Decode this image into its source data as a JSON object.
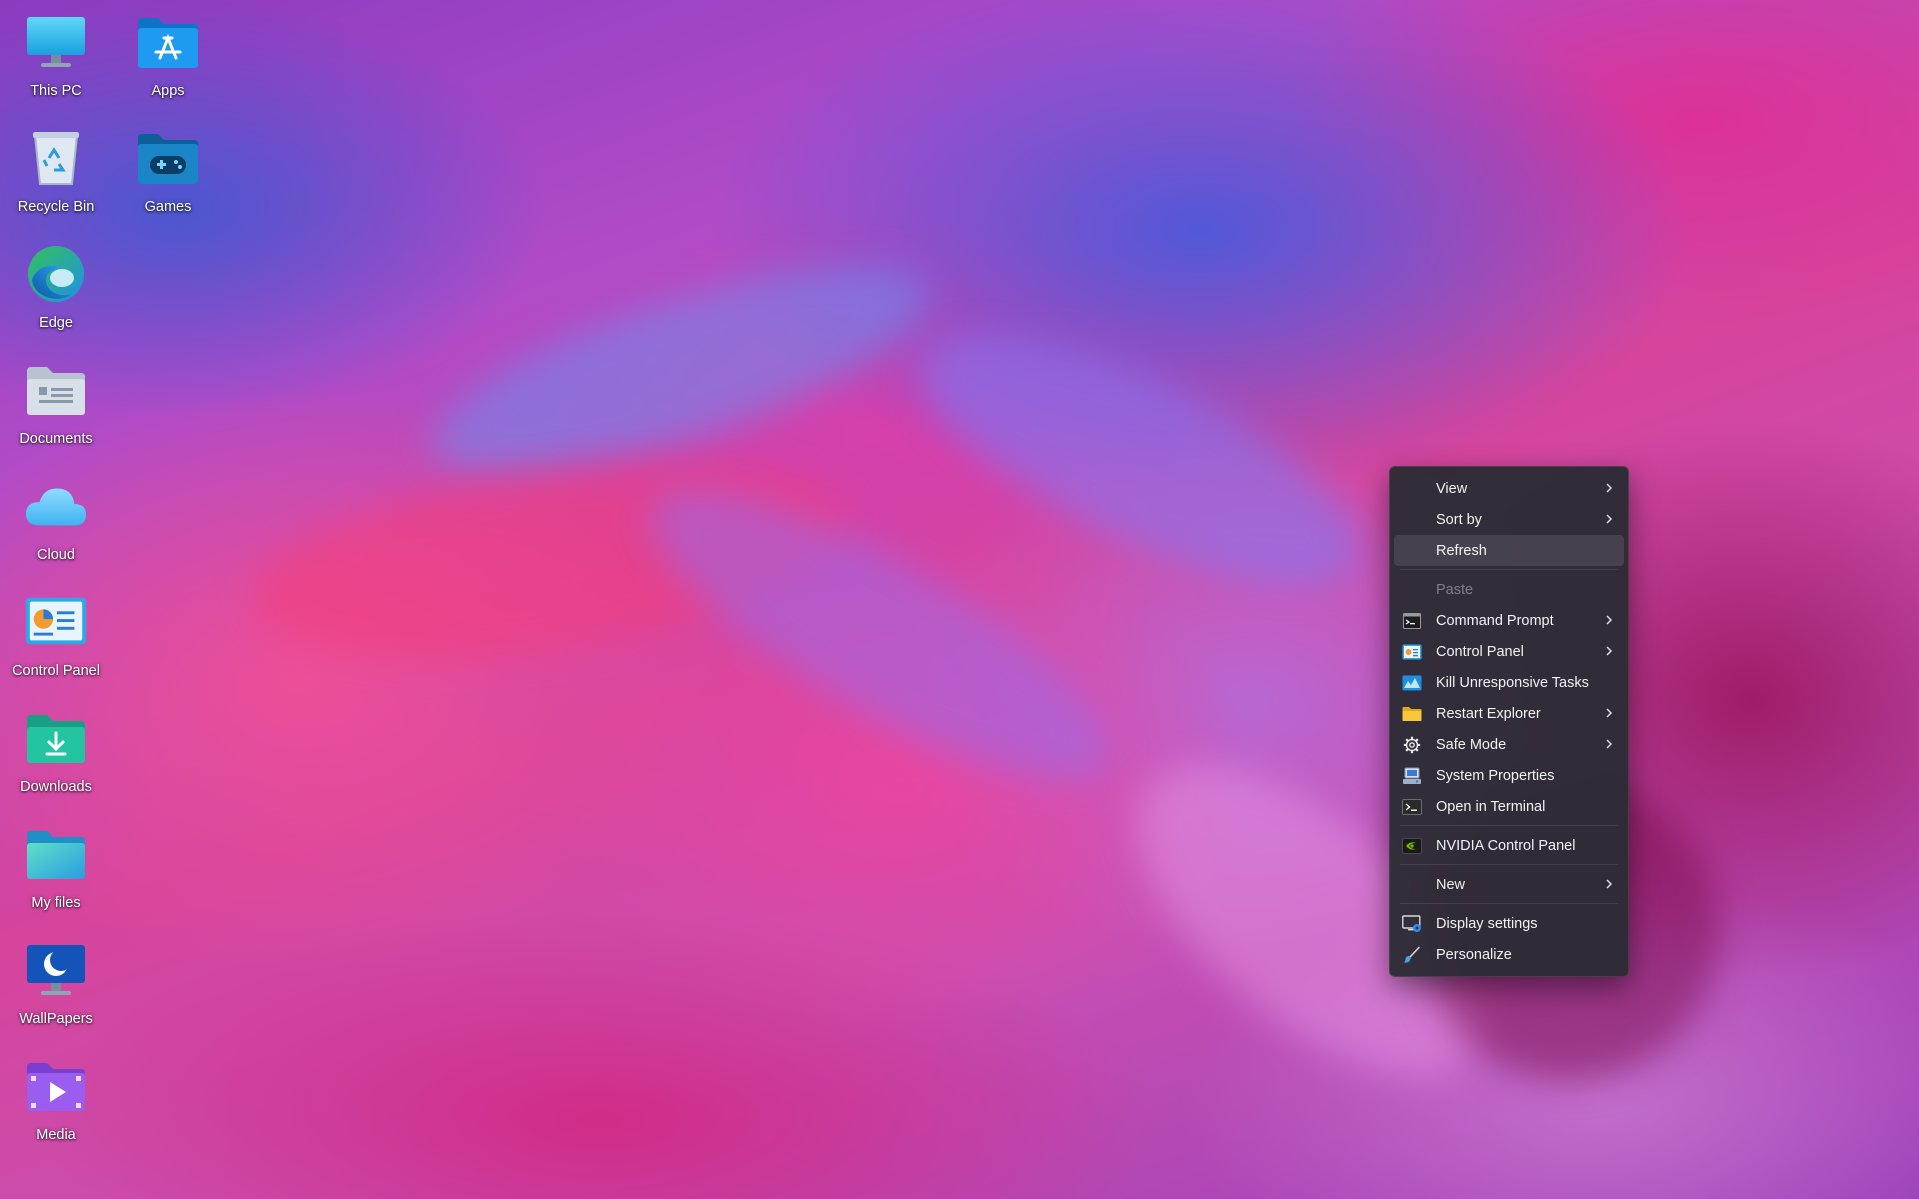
{
  "desktop": {
    "icons": [
      {
        "label": "This PC",
        "icon": "monitor-icon"
      },
      {
        "label": "Apps",
        "icon": "app-store-folder-icon"
      },
      {
        "label": "Recycle Bin",
        "icon": "recycle-bin-icon"
      },
      {
        "label": "Games",
        "icon": "games-folder-icon"
      },
      {
        "label": "Edge",
        "icon": "edge-browser-icon"
      },
      {
        "label": "Documents",
        "icon": "documents-folder-icon"
      },
      {
        "label": "Cloud",
        "icon": "cloud-icon"
      },
      {
        "label": "Control Panel",
        "icon": "control-panel-icon"
      },
      {
        "label": "Downloads",
        "icon": "downloads-folder-icon"
      },
      {
        "label": "My files",
        "icon": "folder-icon"
      },
      {
        "label": "WallPapers",
        "icon": "wallpapers-monitor-icon"
      },
      {
        "label": "Media",
        "icon": "media-folder-icon"
      }
    ]
  },
  "context_menu": {
    "items": [
      {
        "label": "View",
        "submenu": true
      },
      {
        "label": "Sort by",
        "submenu": true
      },
      {
        "label": "Refresh",
        "highlighted": true
      },
      {
        "label": "Paste",
        "disabled": true
      },
      {
        "label": "Command Prompt",
        "icon": "command-prompt-icon",
        "submenu": true
      },
      {
        "label": "Control Panel",
        "icon": "control-panel-icon",
        "submenu": true
      },
      {
        "label": "Kill Unresponsive Tasks",
        "icon": "task-monitor-icon"
      },
      {
        "label": "Restart Explorer",
        "icon": "folder-icon",
        "submenu": true
      },
      {
        "label": "Safe Mode",
        "icon": "gear-icon",
        "submenu": true
      },
      {
        "label": "System Properties",
        "icon": "system-properties-icon"
      },
      {
        "label": "Open in Terminal",
        "icon": "terminal-icon"
      },
      {
        "label": "NVIDIA Control Panel",
        "icon": "nvidia-icon"
      },
      {
        "label": "New",
        "submenu": true
      },
      {
        "label": "Display settings",
        "icon": "display-settings-icon"
      },
      {
        "label": "Personalize",
        "icon": "brush-icon"
      }
    ]
  },
  "colors": {
    "menu_background": "#2c2c34",
    "menu_text": "#f2f2f2",
    "menu_disabled_text": "#7a7a80",
    "accent_blue": "#1e90e8"
  }
}
